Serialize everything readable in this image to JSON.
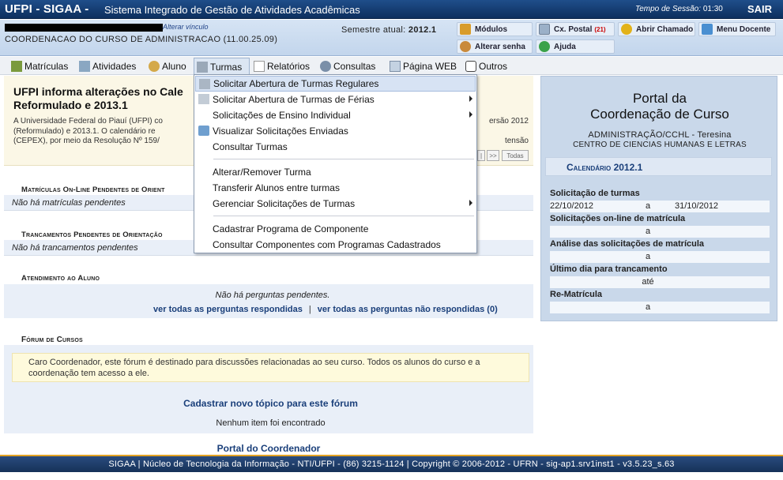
{
  "topbar": {
    "brand": "UFPI - SIGAA -",
    "system_name": "Sistema Integrado de Gestão de Atividades Acadêmicas",
    "session_label": "Tempo de Sessão:",
    "session_time": "01:30",
    "logout": "SAIR"
  },
  "infobar": {
    "alterar_vinculo": "Alterar vínculo",
    "coordination": "COORDENACAO DO CURSO DE ADMINISTRACAO (11.00.25.09)",
    "semester_label": "Semestre atual:",
    "semester_value": "2012.1",
    "buttons": {
      "modulos": "Módulos",
      "cx_postal": "Cx. Postal",
      "cx_postal_count": "(21)",
      "abrir_chamado": "Abrir Chamado",
      "menu_docente": "Menu Docente",
      "alterar_senha": "Alterar senha",
      "ajuda": "Ajuda"
    }
  },
  "menubar": {
    "items": [
      "Matrículas",
      "Atividades",
      "Aluno",
      "Turmas",
      "Relatórios",
      "Consultas",
      "Página WEB",
      "Outros"
    ]
  },
  "dropdown": {
    "items": [
      "Solicitar Abertura de Turmas Regulares",
      "Solicitar Abertura de Turmas de Férias",
      "Solicitações de Ensino Individual",
      "Visualizar Solicitações Enviadas",
      "Consultar Turmas",
      "Alterar/Remover Turma",
      "Transferir Alunos entre turmas",
      "Gerenciar Solicitações de Turmas",
      "Cadastrar Programa de Componente",
      "Consultar Componentes com Programas Cadastrados"
    ]
  },
  "notice": {
    "title_line1": "UFPI informa alterações no Cale",
    "title_line2": "Reformulado e 2013.1",
    "body_line1": "A Universidade Federal do Piauí (UFPI) co",
    "body_line2": "(Reformulado) e 2013.1. O calendário re",
    "body_line3": "(CEPEX), por meio da Resolução Nº 159/",
    "body_right1": "ersão 2012",
    "body_right2": "tensão",
    "pager_next": ">>",
    "pager_all": "Todas"
  },
  "sections": {
    "matriculas_title": "Matrículas On-Line Pendentes de Orient",
    "matriculas_empty": "Não há matrículas pendentes",
    "trancamentos_title": "Trancamentos Pendentes de Orientação",
    "trancamentos_empty": "Não há trancamentos pendentes",
    "atendimento_title": "Atendimento ao Aluno",
    "atendimento_empty": "Não há perguntas pendentes.",
    "link_respondidas": "ver todas as perguntas respondidas",
    "link_sep": "|",
    "link_nao_respondidas": "ver todas as perguntas não respondidas (0)",
    "forum_title": "Fórum de Cursos",
    "forum_note": "Caro Coordenador, este fórum é destinado para discussões relacionadas ao seu curso. Todos os alunos do curso e a coordenação tem acesso a ele.",
    "forum_cadastrar": "Cadastrar novo tópico para este fórum",
    "forum_empty": "Nenhum item foi encontrado",
    "portal_link": "Portal do Coordenador"
  },
  "rightpanel": {
    "title_line1": "Portal da",
    "title_line2": "Coordenação de Curso",
    "subtitle1": "ADMINISTRAÇÃO/CCHL - Teresina",
    "subtitle2": "CENTRO DE CIENCIAS HUMANAS E LETRAS",
    "calendar_label": "Calendário",
    "calendar_year": "2012.1",
    "rows": [
      {
        "label": "Solicitação de turmas",
        "start": "22/10/2012",
        "mid": "a",
        "end": "31/10/2012"
      },
      {
        "label": "Solicitações on-line de matrícula",
        "start": "",
        "mid": "a",
        "end": ""
      },
      {
        "label": "Análise das solicitações de matrícula",
        "start": "",
        "mid": "a",
        "end": ""
      },
      {
        "label": "Último dia para trancamento",
        "start": "",
        "mid": "até",
        "end": ""
      },
      {
        "label": "Re-Matrícula",
        "start": "",
        "mid": "a",
        "end": ""
      }
    ]
  },
  "footer": {
    "text": "SIGAA | Núcleo de Tecnologia da Informação - NTI/UFPI - (86) 3215-1124 | Copyright © 2006-2012 - UFRN - sig-ap1.srv1inst1 - v3.5.23_s.63"
  },
  "colors": {
    "topbar": "#0d2f5e",
    "link": "#1a3f7a",
    "footer_accent": "#e3a323"
  }
}
